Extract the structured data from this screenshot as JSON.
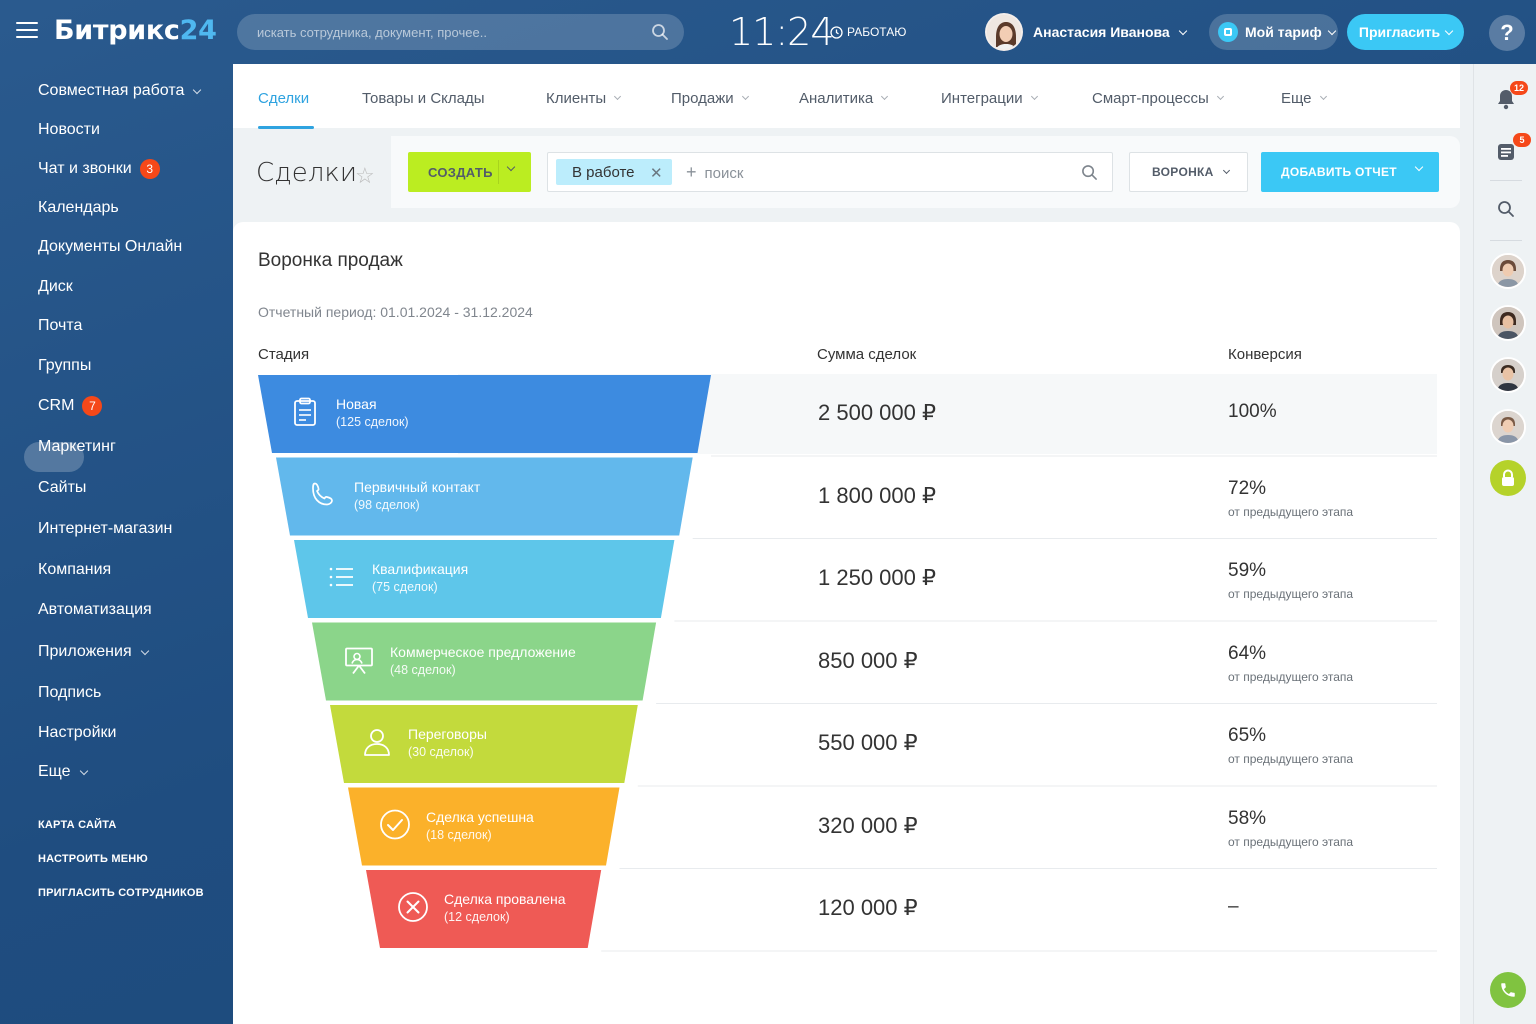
{
  "app": {
    "logo_main": "Битрикс",
    "logo_num": "24"
  },
  "header": {
    "search_placeholder": "искать сотрудника, документ, прочее..",
    "time": "11:24",
    "status": "РАБОТАЮ",
    "user_name": "Анастасия Иванова",
    "tariff_label": "Мой тариф",
    "invite_label": "Пригласить",
    "help_label": "?"
  },
  "sidebar": {
    "items": [
      {
        "label": "Совместная работа",
        "has_arrow": true
      },
      {
        "label": "Новости"
      },
      {
        "label": "Чат и звонки",
        "badge": "3"
      },
      {
        "label": "Календарь"
      },
      {
        "label": "Документы Онлайн"
      },
      {
        "label": "Диск"
      },
      {
        "label": "Почта"
      },
      {
        "label": "Группы"
      },
      {
        "label": "CRM",
        "badge": "7",
        "active": true
      },
      {
        "label": "Маркетинг"
      },
      {
        "label": "Сайты"
      },
      {
        "label": "Интернет-магазин"
      },
      {
        "label": "Компания"
      },
      {
        "label": "Автоматизация"
      },
      {
        "label": "Приложения",
        "has_arrow": true
      },
      {
        "label": "Подпись"
      },
      {
        "label": "Настройки"
      },
      {
        "label": "Еще",
        "has_arrow": true
      }
    ],
    "footer_links": [
      "КАРТА САЙТА",
      "НАСТРОИТЬ МЕНЮ",
      "ПРИГЛАСИТЬ СОТРУДНИКОВ"
    ]
  },
  "tabs": [
    {
      "label": "Сделки",
      "active": true
    },
    {
      "label": "Товары и Склады"
    },
    {
      "label": "Клиенты",
      "has_arrow": true
    },
    {
      "label": "Продажи",
      "has_arrow": true
    },
    {
      "label": "Аналитика",
      "has_arrow": true
    },
    {
      "label": "Интеграции",
      "has_arrow": true
    },
    {
      "label": "Смарт-процессы",
      "has_arrow": true
    },
    {
      "label": "Еще",
      "has_arrow": true
    }
  ],
  "toolbar": {
    "title": "Сделки",
    "create_label": "СОЗДАТЬ",
    "filter_tag": "В работе",
    "search_placeholder": "поиск",
    "funnel_label": "ВОРОНКА",
    "report_label": "ДОБАВИТЬ ОТЧЕТ"
  },
  "report": {
    "title": "Воронка продаж",
    "period": "Отчетный период: 01.01.2024 - 31.12.2024",
    "col_stage": "Стадия",
    "col_sum": "Сумма сделок",
    "col_conv": "Конверсия",
    "stages": [
      {
        "name": "Новая",
        "count": "(125 сделок)",
        "sum": "2 500 000 ₽",
        "conversion": "100%",
        "sub": "",
        "color": "#3d8be0",
        "icon": "clipboard-icon"
      },
      {
        "name": "Первичный контакт",
        "count": "(98 сделок)",
        "sum": "1 800 000 ₽",
        "conversion": "72%",
        "sub": "от предыдущего этапа",
        "color": "#62b8ec",
        "icon": "phone-icon"
      },
      {
        "name": "Квалификация",
        "count": "(75 сделок)",
        "sum": "1 250 000 ₽",
        "conversion": "59%",
        "sub": "от предыдущего этапа",
        "color": "#5ec6ea",
        "icon": "list-icon"
      },
      {
        "name": "Коммерческое предложение",
        "count": "(48 сделок)",
        "sum": "850 000 ₽",
        "conversion": "64%",
        "sub": "от предыдущего этапа",
        "color": "#8bd58a",
        "icon": "presentation-icon"
      },
      {
        "name": "Переговоры",
        "count": "(30 сделок)",
        "sum": "550 000 ₽",
        "conversion": "65%",
        "sub": "от предыдущего этапа",
        "color": "#c3da3c",
        "icon": "person-icon"
      },
      {
        "name": "Сделка успешна",
        "count": "(18 сделок)",
        "sum": "320 000 ₽",
        "conversion": "58%",
        "sub": "от предыдущего этапа",
        "color": "#fbb12a",
        "icon": "check-circle-icon"
      },
      {
        "name": "Сделка провалена",
        "count": "(12 сделок)",
        "sum": "120 000 ₽",
        "conversion": "–",
        "sub": "",
        "color": "#ef5a55",
        "icon": "x-circle-icon"
      }
    ]
  },
  "right_panel": {
    "notifications_badge": "12",
    "tasks_badge": "5"
  }
}
